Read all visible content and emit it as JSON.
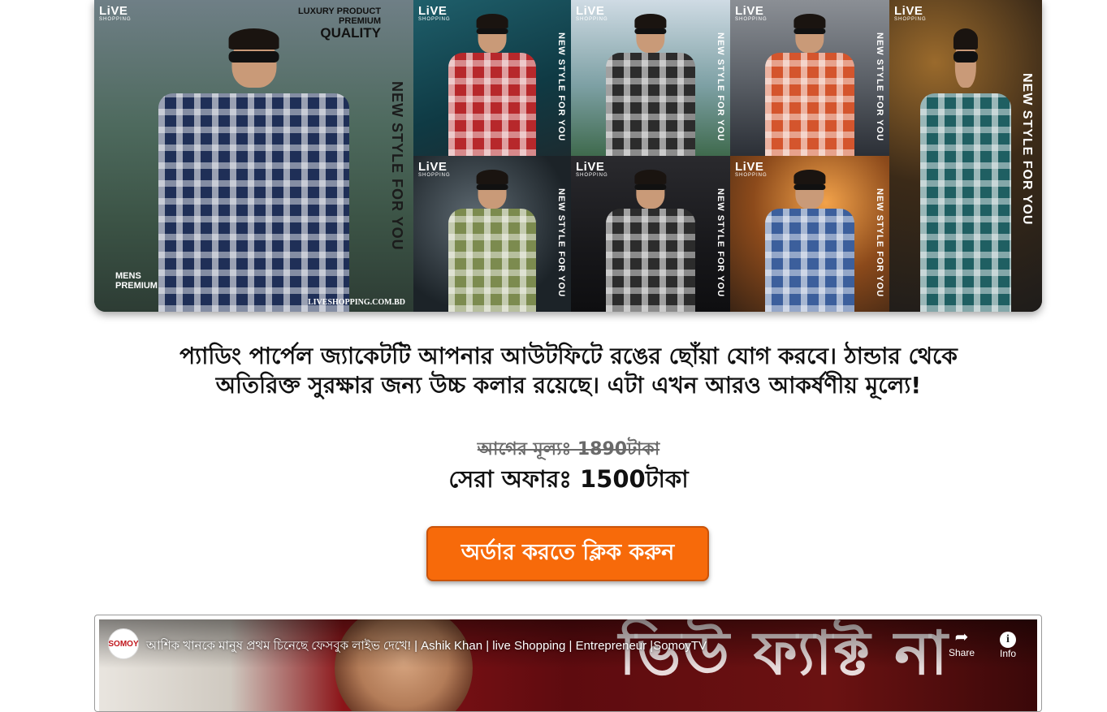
{
  "banner": {
    "brand_logo": "LiVE",
    "brand_sub": "SHOPPING",
    "quality_line1": "LUXURY PRODUCT",
    "quality_line2": "PREMIUM",
    "quality_line3": "QUALITY",
    "slogan": "NEW STYLE FOR YOU",
    "mens_label": "MENS",
    "premium_label": "PREMIUM",
    "website": "LIVESHOPPING.COM.BD"
  },
  "product": {
    "description_line1": "প্যাডিং পার্পেল জ্যাকেটটি আপনার আউটফিটে রঙের ছোঁয়া যোগ করবে। ঠান্ডার থেকে",
    "description_line2": "অতিরিক্ত সুরক্ষার জন্য উচ্চ কলার রয়েছে। এটা এখন আরও আকর্ষণীয় মূল্যে!",
    "old_price": "আগের মূল্যঃ 1890টাকা",
    "offer_price": "সেরা অফারঃ 1500টাকা",
    "order_button": "অর্ডার করতে ক্লিক করুন"
  },
  "video": {
    "title": "আশিক খানকে মানুষ প্রথম চিনেছে ফেসবুক লাইভ দেখে! | Ashik Khan | live Shopping | Entrepreneur |SomoyTV",
    "background_text": "ভিউ ফ্যাক্ট না",
    "share_label": "Share",
    "info_label": "Info",
    "channel_badge": "SOMOY"
  },
  "colors": {
    "accent": "#f76a0a",
    "text": "#111111",
    "strike_price": "#6a6a6a"
  },
  "icons": {
    "share": "share-arrow-icon",
    "info": "info-circle-icon"
  }
}
